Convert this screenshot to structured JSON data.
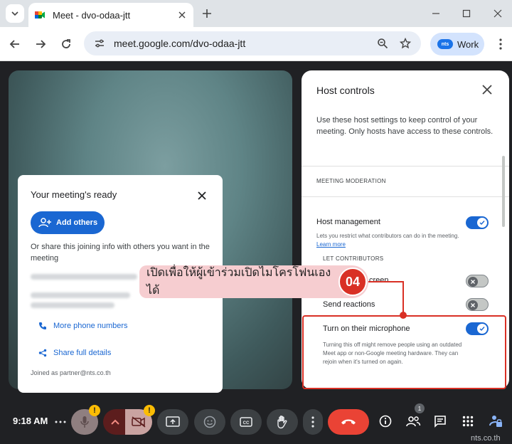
{
  "browser": {
    "tab_title": "Meet - dvo-odaa-jtt",
    "url": "meet.google.com/dvo-odaa-jtt",
    "profile_logo": "nts",
    "profile_name": "Work"
  },
  "ready_card": {
    "title": "Your meeting's ready",
    "add_others": "Add others",
    "share_text": "Or share this joining info with others you want in the meeting",
    "more_phone": "More phone numbers",
    "share_details": "Share full details",
    "joined_as": "Joined as partner@nts.co.th"
  },
  "host_controls": {
    "title": "Host controls",
    "description": "Use these host settings to keep control of your meeting. Only hosts have access to these controls.",
    "section": "MEETING MODERATION",
    "host_management_label": "Host management",
    "host_management_desc": "Lets you restrict what contributors can do in the meeting.",
    "learn_more": "Learn more",
    "let_contributors": "LET CONTRIBUTORS",
    "share_screen_fragment": "creen",
    "send_reactions": "Send reactions",
    "microphone_label": "Turn on their microphone",
    "microphone_desc": "Turning this off might remove people using an outdated Meet app or non-Google meeting hardware. They can rejoin when it's turned on again.",
    "toggles": {
      "host_management": true,
      "share_screen": false,
      "send_reactions": false,
      "microphone": true
    }
  },
  "annotation": {
    "text": "เปิดเพื่อให้ผู้เข้าร่วมเปิดไมโครโฟนเองได้",
    "number": "04"
  },
  "bottom_bar": {
    "time": "9:18 AM",
    "warn_mark": "!",
    "people_count": "1"
  },
  "watermark": "nts.co.th",
  "colors": {
    "accent": "#1a67d2",
    "annotation": "#d93025",
    "end_call": "#ea4335"
  }
}
